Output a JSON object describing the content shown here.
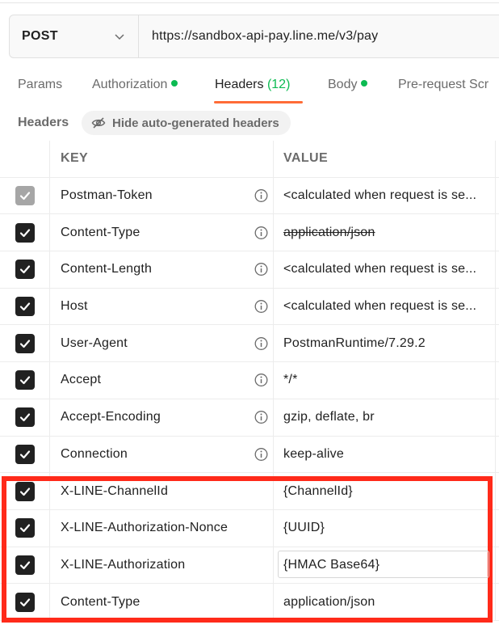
{
  "request": {
    "method": "POST",
    "url": "https://sandbox-api-pay.line.me/v3/pay"
  },
  "tabs": [
    {
      "label": "Params",
      "dot": false
    },
    {
      "label": "Authorization",
      "dot": true
    },
    {
      "label": "Headers",
      "count": "(12)",
      "active": true
    },
    {
      "label": "Body",
      "dot": true
    },
    {
      "label": "Pre-request Scr",
      "dot": false
    }
  ],
  "headers_section": {
    "label": "Headers",
    "hide_button": "Hide auto-generated headers"
  },
  "table": {
    "columns": {
      "key": "KEY",
      "value": "VALUE"
    },
    "rows": [
      {
        "key": "Postman-Token",
        "value": "<calculated when request is se...",
        "checked": true,
        "disabled": true,
        "info": true,
        "strike": false
      },
      {
        "key": "Content-Type",
        "value": "application/json",
        "checked": true,
        "disabled": false,
        "info": true,
        "strike": true
      },
      {
        "key": "Content-Length",
        "value": "<calculated when request is se...",
        "checked": true,
        "disabled": false,
        "info": true,
        "strike": false
      },
      {
        "key": "Host",
        "value": "<calculated when request is se...",
        "checked": true,
        "disabled": false,
        "info": true,
        "strike": false
      },
      {
        "key": "User-Agent",
        "value": "PostmanRuntime/7.29.2",
        "checked": true,
        "disabled": false,
        "info": true,
        "strike": false
      },
      {
        "key": "Accept",
        "value": "*/*",
        "checked": true,
        "disabled": false,
        "info": true,
        "strike": false
      },
      {
        "key": "Accept-Encoding",
        "value": "gzip, deflate, br",
        "checked": true,
        "disabled": false,
        "info": true,
        "strike": false
      },
      {
        "key": "Connection",
        "value": "keep-alive",
        "checked": true,
        "disabled": false,
        "info": true,
        "strike": false
      },
      {
        "key": "X-LINE-ChannelId",
        "value": "{ChannelId}",
        "checked": true,
        "disabled": false,
        "info": false,
        "strike": false
      },
      {
        "key": "X-LINE-Authorization-Nonce",
        "value": "{UUID}",
        "checked": true,
        "disabled": false,
        "info": false,
        "strike": false
      },
      {
        "key": "X-LINE-Authorization",
        "value": "{HMAC Base64}",
        "checked": true,
        "disabled": false,
        "info": false,
        "strike": false
      },
      {
        "key": "Content-Type",
        "value": "application/json",
        "checked": true,
        "disabled": false,
        "info": false,
        "strike": false
      }
    ]
  },
  "colors": {
    "accent": "#ff6c37",
    "status_dot": "#0cbb52",
    "highlight": "#ff2a1a"
  }
}
